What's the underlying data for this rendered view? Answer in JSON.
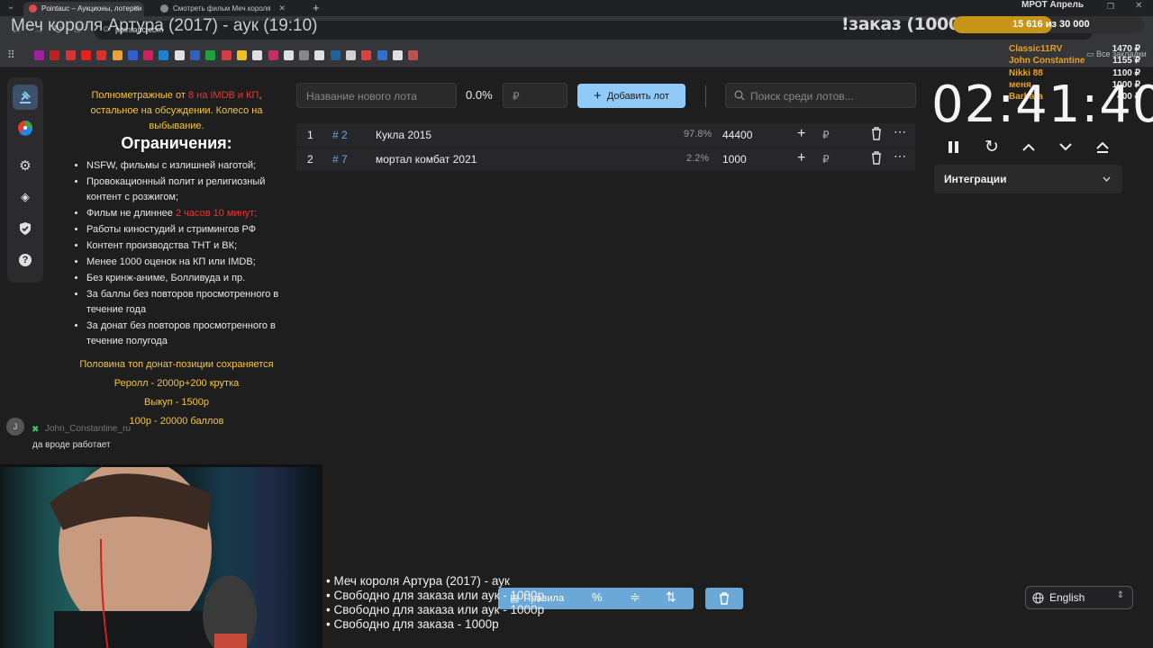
{
  "browser": {
    "tabs": [
      {
        "title": "Pointauc – Аукционы, лотереи",
        "active": true
      },
      {
        "title": "Смотреть фильм Меч короля",
        "active": false
      }
    ],
    "url": "pointauc.com"
  },
  "stream_overlay": {
    "title": "Меч короля Артура (2017) - аук (19:10)",
    "order_label": "!заказ (1000р)",
    "goal": {
      "title": "МРОТ Апрель",
      "text": "15 616 из 30 000",
      "current": 15616,
      "target": 30000
    },
    "top_donors": [
      {
        "name": "Classic11RV",
        "amount": "1470 ₽"
      },
      {
        "name": "John Constantine",
        "amount": "1155 ₽"
      },
      {
        "name": "Nikki 88",
        "amount": "1100 ₽"
      },
      {
        "name": "меня",
        "amount": "1000 ₽"
      },
      {
        "name": "Barbara",
        "amount": "400 ₽"
      }
    ],
    "bottom_lines": [
      "• Меч короля Артура (2017) - аук",
      "• Свободно для заказа или аук - 1000р",
      "• Свободно для заказа или аук - 1000р",
      "• Свободно для заказа - 1000р"
    ],
    "chat": {
      "avatar": "J",
      "user": "John_Constantine_ru",
      "message": "да вроде работает"
    }
  },
  "rules": {
    "intro_a": "Полнометражные от ",
    "intro_red": "8 на IMDB и КП",
    "intro_b": ", остальное на обсуждении. Колесо на выбывание.",
    "heading": "Ограничения:",
    "items": [
      "NSFW, фильмы с излишней наготой;",
      "Провокационный полит и религиозный контент с розжигом;",
      "Фильм не длиннее ",
      "Работы киностудий и стримингов РФ",
      "Контент производства ТНТ и ВК;",
      "Менее 1000 оценок на КП или IMDB;",
      "Без кринж-аниме, Болливуда и пр.",
      "За баллы без повторов просмотренного в течение года",
      "За донат без повторов просмотренного в течение полугода"
    ],
    "duration_red": "2 часов 10 минут;",
    "footer": [
      "Половина топ донат-позиции сохраняется",
      "Реролл - 2000р+200 крутка",
      "Выкуп - 1500р",
      "100р - 20000 баллов"
    ]
  },
  "toolbar": {
    "lot_name_placeholder": "Название нового лота",
    "percent": "0.0%",
    "amount_placeholder": "₽",
    "add_label": "Добавить лот",
    "search_placeholder": "Поиск среди лотов..."
  },
  "lots": [
    {
      "num": "1",
      "id": "# 2",
      "name": "Кукла 2015",
      "pct": "97.8%",
      "amount": "44400",
      "currency": "₽"
    },
    {
      "num": "2",
      "id": "# 7",
      "name": "мортал комбат 2021",
      "pct": "2.2%",
      "amount": "1000",
      "currency": "₽"
    }
  ],
  "timer": {
    "time": "02:41:40"
  },
  "integrations": {
    "label": "Интеграции"
  },
  "bottom_bar": {
    "rules_label": "Правила",
    "percent_icon": "%"
  },
  "language": {
    "label": "English"
  },
  "colors": {
    "accent": "#90caf9",
    "goal": "#c89418",
    "link": "#64a8e6",
    "warning": "#e53935",
    "highlight": "#f4c542"
  }
}
